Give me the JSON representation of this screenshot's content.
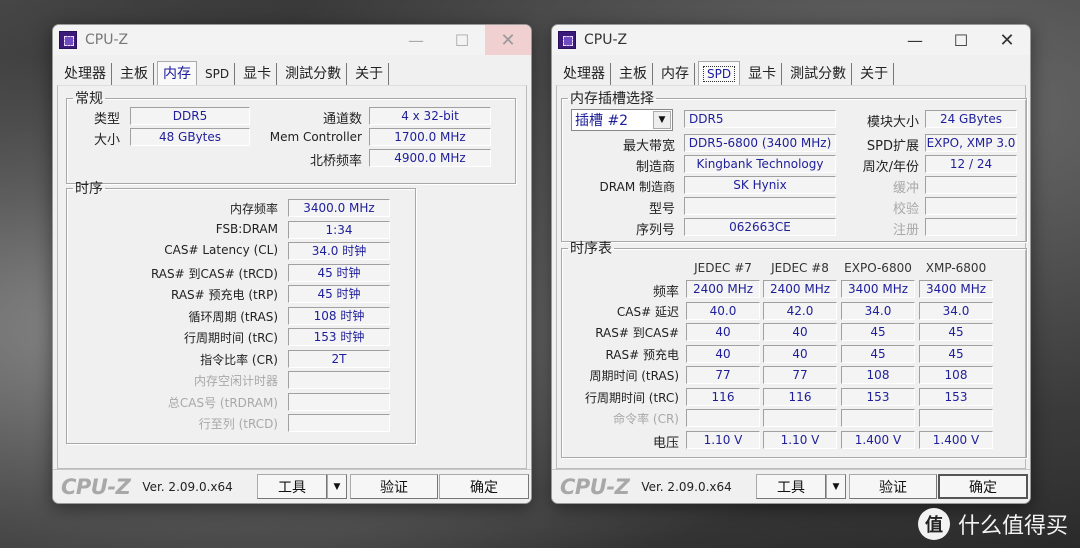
{
  "watermark": {
    "badge": "值",
    "text": "什么值得买"
  },
  "left_window": {
    "title": "CPU-Z",
    "controls": {
      "minimize": "—",
      "maximize": "☐",
      "close": "✕"
    },
    "tabs": [
      "处理器",
      "主板",
      "内存",
      "SPD",
      "显卡",
      "測試分數",
      "关于"
    ],
    "active_tab": "内存",
    "general": {
      "legend": "常规",
      "type_label": "类型",
      "type_value": "DDR5",
      "size_label": "大小",
      "size_value": "48 GBytes",
      "channels_label": "通道数",
      "channels_value": "4 x 32-bit",
      "memctrl_label": "Mem Controller",
      "memctrl_value": "1700.0 MHz",
      "nb_label": "北桥频率",
      "nb_value": "4900.0 MHz"
    },
    "timings": {
      "legend": "时序",
      "rows": [
        {
          "label": "内存频率",
          "value": "3400.0 MHz",
          "dim": false
        },
        {
          "label": "FSB:DRAM",
          "value": "1:34",
          "dim": false
        },
        {
          "label": "CAS# Latency (CL)",
          "value": "34.0 时钟",
          "dim": false
        },
        {
          "label": "RAS# 到CAS# (tRCD)",
          "value": "45 时钟",
          "dim": false
        },
        {
          "label": "RAS# 预充电 (tRP)",
          "value": "45 时钟",
          "dim": false
        },
        {
          "label": "循环周期 (tRAS)",
          "value": "108 时钟",
          "dim": false
        },
        {
          "label": "行周期时间 (tRC)",
          "value": "153 时钟",
          "dim": false
        },
        {
          "label": "指令比率 (CR)",
          "value": "2T",
          "dim": false
        },
        {
          "label": "内存空闲计时器",
          "value": "",
          "dim": true
        },
        {
          "label": "总CAS号 (tRDRAM)",
          "value": "",
          "dim": true
        },
        {
          "label": "行至列 (tRCD)",
          "value": "",
          "dim": true
        }
      ]
    },
    "footer": {
      "brand": "CPU-Z",
      "version": "Ver. 2.09.0.x64",
      "tools": "工具",
      "tools_arrow": "▼",
      "validate": "验证",
      "ok": "确定"
    }
  },
  "right_window": {
    "title": "CPU-Z",
    "controls": {
      "minimize": "—",
      "maximize": "☐",
      "close": "✕"
    },
    "tabs": [
      "处理器",
      "主板",
      "内存",
      "SPD",
      "显卡",
      "測試分數",
      "关于"
    ],
    "active_tab": "SPD",
    "slot": {
      "legend": "内存插槽选择",
      "slot_select": "插槽 #2",
      "slot_arrow": "▼",
      "mem_type": "DDR5",
      "max_bw_label": "最大带宽",
      "max_bw_value": "DDR5-6800 (3400 MHz)",
      "manufacturer_label": "制造商",
      "manufacturer_value": "Kingbank Technology",
      "dram_mfr_label": "DRAM 制造商",
      "dram_mfr_value": "SK Hynix",
      "part_label": "型号",
      "part_value": "",
      "serial_label": "序列号",
      "serial_value": "062663CE",
      "module_size_label": "模块大小",
      "module_size_value": "24 GBytes",
      "spd_ext_label": "SPD扩展",
      "spd_ext_value": "EXPO, XMP 3.0",
      "week_year_label": "周次/年份",
      "week_year_value": "12 / 24",
      "buffered_label": "缓冲",
      "buffered_value": "",
      "ecc_label": "校验",
      "ecc_value": "",
      "registered_label": "注册",
      "registered_value": ""
    },
    "timing_table": {
      "legend": "时序表",
      "columns": [
        "JEDEC #7",
        "JEDEC #8",
        "EXPO-6800",
        "XMP-6800"
      ],
      "rows": [
        {
          "label": "频率",
          "dim": false,
          "values": [
            "2400 MHz",
            "2400 MHz",
            "3400 MHz",
            "3400 MHz"
          ]
        },
        {
          "label": "CAS# 延迟",
          "dim": false,
          "values": [
            "40.0",
            "42.0",
            "34.0",
            "34.0"
          ]
        },
        {
          "label": "RAS# 到CAS#",
          "dim": false,
          "values": [
            "40",
            "40",
            "45",
            "45"
          ]
        },
        {
          "label": "RAS# 预充电",
          "dim": false,
          "values": [
            "40",
            "40",
            "45",
            "45"
          ]
        },
        {
          "label": "周期时间 (tRAS)",
          "dim": false,
          "values": [
            "77",
            "77",
            "108",
            "108"
          ]
        },
        {
          "label": "行周期时间 (tRC)",
          "dim": false,
          "values": [
            "116",
            "116",
            "153",
            "153"
          ]
        },
        {
          "label": "命令率 (CR)",
          "dim": true,
          "values": [
            "",
            "",
            "",
            ""
          ]
        },
        {
          "label": "电压",
          "dim": false,
          "values": [
            "1.10 V",
            "1.10 V",
            "1.400 V",
            "1.400 V"
          ]
        }
      ]
    },
    "footer": {
      "brand": "CPU-Z",
      "version": "Ver. 2.09.0.x64",
      "tools": "工具",
      "tools_arrow": "▼",
      "validate": "验证",
      "ok": "确定"
    }
  }
}
